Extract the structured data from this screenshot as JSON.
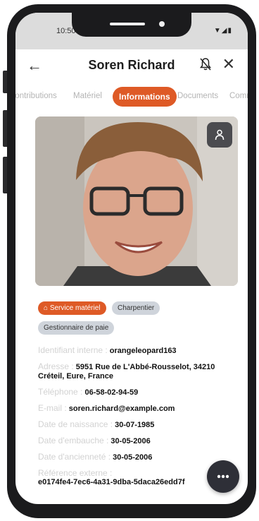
{
  "status": {
    "time": "10:50"
  },
  "header": {
    "title": "Soren Richard"
  },
  "tabs": [
    {
      "label": "Contributions"
    },
    {
      "label": "Matériel"
    },
    {
      "label": "Informations"
    },
    {
      "label": "Documents"
    },
    {
      "label": "Comm"
    }
  ],
  "chips": [
    {
      "label": "Service matériel"
    },
    {
      "label": "Charpentier"
    },
    {
      "label": "Gestionnaire de paie"
    }
  ],
  "info": {
    "internal_id_label": "Identifiant interne :",
    "internal_id": "orangeleopard163",
    "address_label": "Adresse :",
    "address": "5951 Rue de L'Abbé-Rousselot, 34210 Créteil, Eure, France",
    "phone_label": "Téléphone :",
    "phone": "06-58-02-94-59",
    "email_label": "E-mail :",
    "email": "soren.richard@example.com",
    "birth_label": "Date de naissance :",
    "birth": "30-07-1985",
    "hire_label": "Date d'embauche :",
    "hire": "30-05-2006",
    "seniority_label": "Date d'ancienneté :",
    "seniority": "30-05-2006",
    "external_ref_label": "Référence externe :",
    "external_ref": "e0174fe4-7ec6-4a31-9dba-5daca26edd7f"
  },
  "colors": {
    "accent": "#de5a26",
    "chip_grey": "#cfd4db",
    "fab": "#2e2f37"
  }
}
